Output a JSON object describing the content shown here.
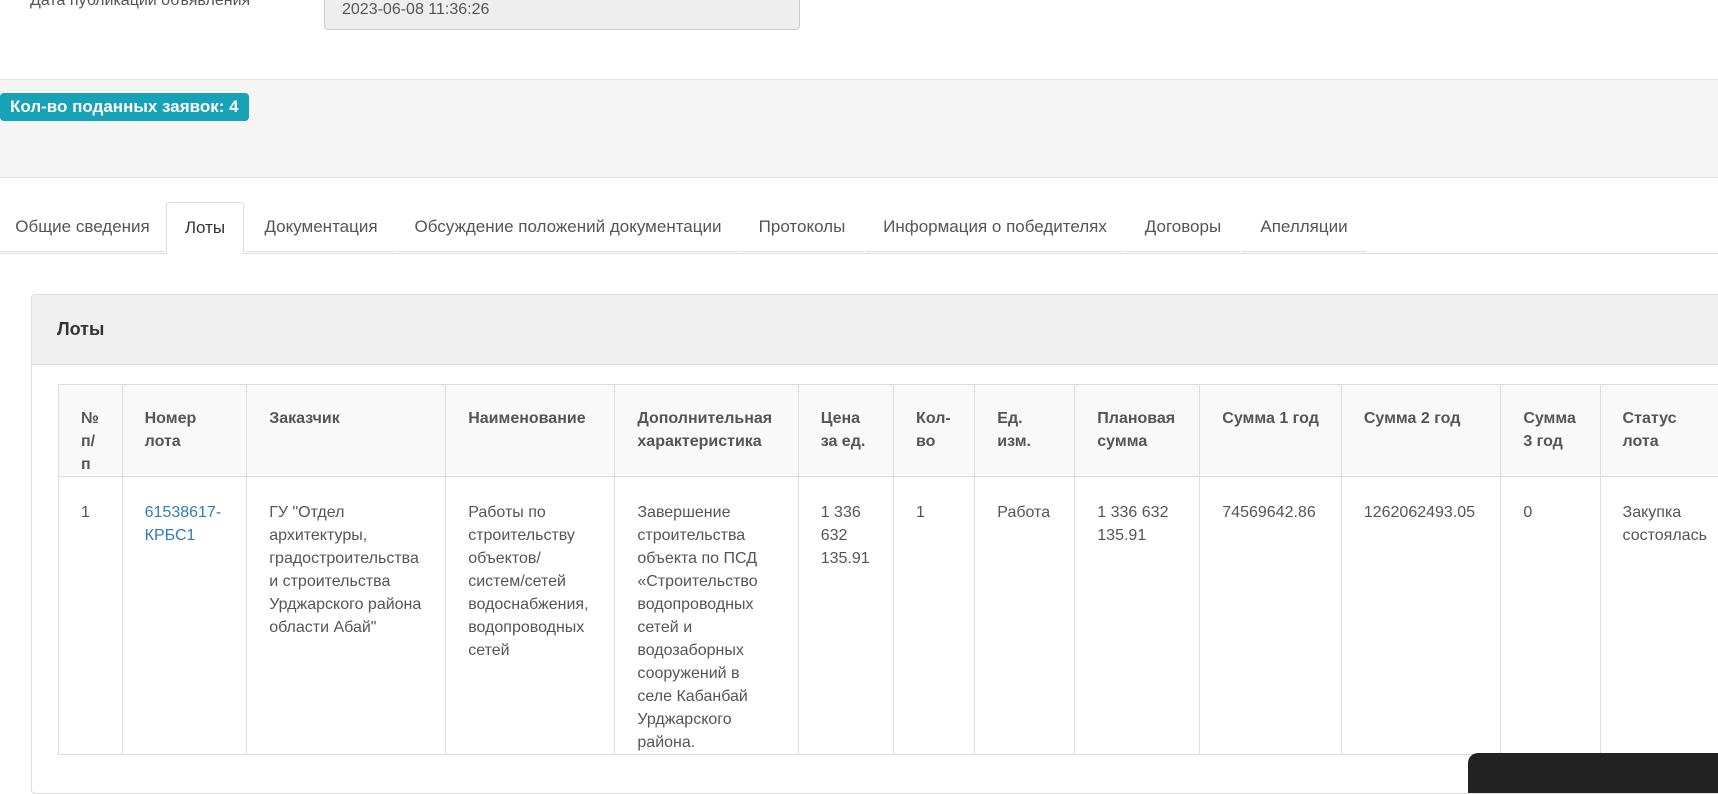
{
  "publication": {
    "label": "Дата публикации объявления",
    "value": "2023-06-08 11:36:26"
  },
  "badge": {
    "text": "Кол-во поданных заявок: 4"
  },
  "tabs": [
    {
      "label": "Общие сведения"
    },
    {
      "label": "Лоты"
    },
    {
      "label": "Документация"
    },
    {
      "label": "Обсуждение положений документации"
    },
    {
      "label": "Протоколы"
    },
    {
      "label": "Информация о победителях"
    },
    {
      "label": "Договоры"
    },
    {
      "label": "Апелляции"
    }
  ],
  "lots_panel": {
    "title": "Лоты",
    "headers": [
      "№ п/ п",
      "Номер лота",
      "Заказчик",
      "Наименование",
      "Дополнительная характеристика",
      "Цена за ед.",
      "Кол-во",
      "Ед. изм.",
      "Плановая сумма",
      "Сумма 1 год",
      "Сумма 2 год",
      "Сумма 3 год",
      "Статус лота"
    ],
    "rows": [
      {
        "num": "1",
        "lot_number": "61538617-КРБС1",
        "customer": "ГУ \"Отдел архитектуры, градостроительства и строительства Урджарского района области Абай\"",
        "name": "Работы по строительству объектов/ систем/сетей водоснабжения, водопроводных сетей",
        "extra": "Завершение строительства объекта по ПСД «Строительство водопроводных сетей и водозаборных сооружений в селе Кабанбай Урджарского района.",
        "price": "1 336 632 135.91",
        "qty": "1",
        "unit": "Работа",
        "planned": "1 336 632 135.91",
        "sum1": "74569642.86",
        "sum2": "1262062493.05",
        "sum3": "0",
        "status": "Закупка состоялась"
      }
    ]
  }
}
